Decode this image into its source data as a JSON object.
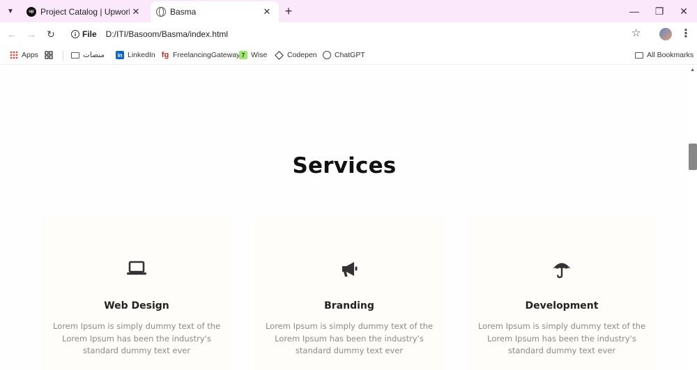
{
  "browser": {
    "tabs": [
      {
        "title": "Project Catalog | Upwork",
        "active": false,
        "favicon": "upwork-icon"
      },
      {
        "title": "Basma",
        "active": true,
        "favicon": "globe-icon"
      }
    ],
    "address": {
      "scheme_label": "File",
      "url": "D:/ITI/Basoom/Basma/index.html"
    },
    "bookmarks": [
      {
        "label": "Apps",
        "icon": "apps-icon"
      },
      {
        "label": "",
        "icon": "grid-icon"
      },
      {
        "label": "منصات",
        "icon": "folder-icon"
      },
      {
        "label": "LinkedIn",
        "icon": "linkedin-icon"
      },
      {
        "label": "FreelancingGateway",
        "icon": "freelancing-gateway-icon"
      },
      {
        "label": "Wise",
        "icon": "wise-icon"
      },
      {
        "label": "Codepen",
        "icon": "codepen-icon"
      },
      {
        "label": "ChatGPT",
        "icon": "chatgpt-icon"
      }
    ],
    "all_bookmarks_label": "All Bookmarks"
  },
  "page": {
    "services_title": "Services",
    "services": [
      {
        "name": "Web Design",
        "icon": "laptop-icon",
        "description": "Lorem Ipsum is simply dummy text of the Lorem Ipsum has been the industry's standard dummy text ever"
      },
      {
        "name": "Branding",
        "icon": "megaphone-icon",
        "description": "Lorem Ipsum is simply dummy text of the Lorem Ipsum has been the industry's standard dummy text ever"
      },
      {
        "name": "Development",
        "icon": "umbrella-icon",
        "description": "Lorem Ipsum is simply dummy text of the Lorem Ipsum has been the industry's standard dummy text ever"
      }
    ]
  },
  "colors": {
    "tabstrip_bg": "#fbe9fb",
    "heading": "#111111",
    "card_title": "#222222",
    "card_text": "#8a8a8a",
    "icon": "#333333"
  }
}
